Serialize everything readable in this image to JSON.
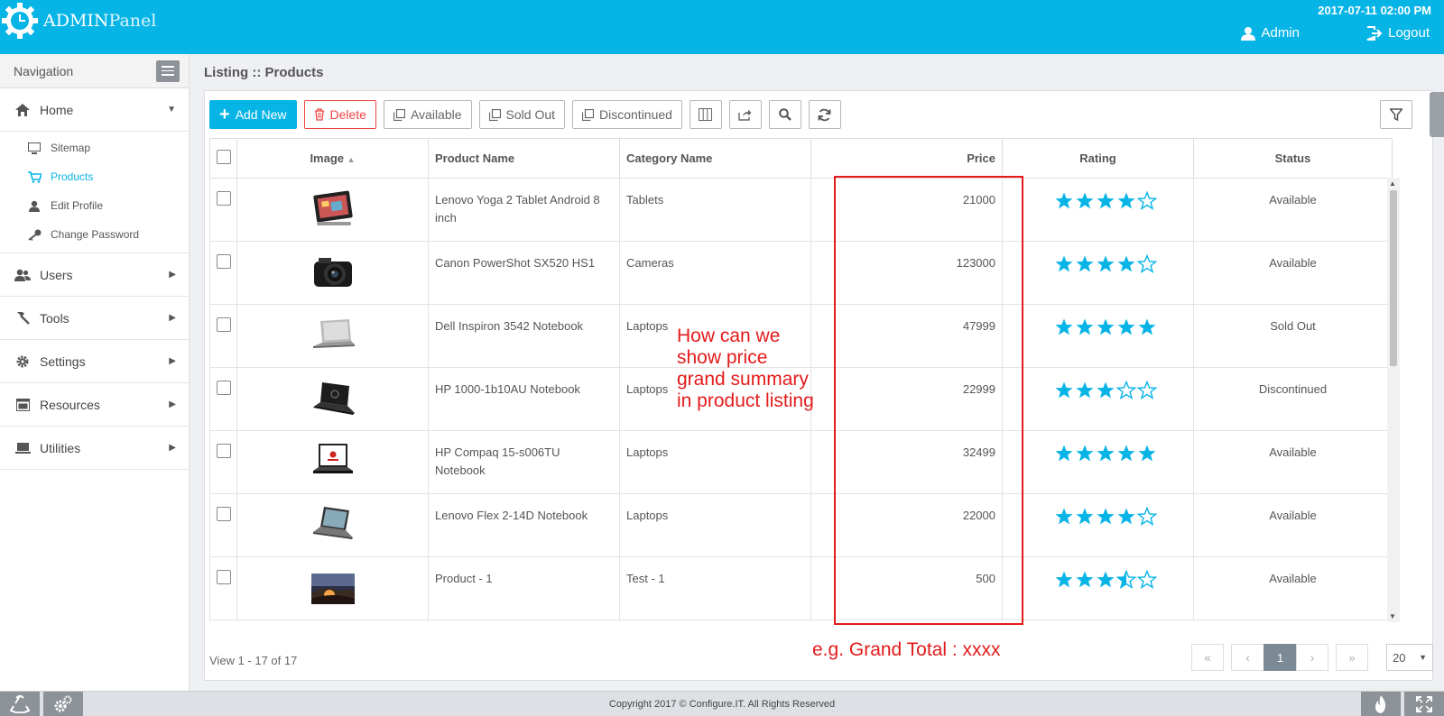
{
  "header": {
    "brand_bold": "ADMIN",
    "brand_light": "Panel",
    "datetime": "2017-07-11 02:00 PM",
    "user_label": "Admin",
    "logout_label": "Logout"
  },
  "sidebar": {
    "title": "Navigation",
    "items": [
      {
        "label": "Home",
        "icon": "home-icon"
      },
      {
        "label": "Users",
        "icon": "users-icon"
      },
      {
        "label": "Tools",
        "icon": "hammer-icon"
      },
      {
        "label": "Settings",
        "icon": "gear-icon"
      },
      {
        "label": "Resources",
        "icon": "window-icon"
      },
      {
        "label": "Utilities",
        "icon": "laptop-icon"
      }
    ],
    "sub_items": [
      {
        "label": "Sitemap",
        "icon": "monitor-icon"
      },
      {
        "label": "Products",
        "icon": "cart-icon"
      },
      {
        "label": "Edit Profile",
        "icon": "user-icon"
      },
      {
        "label": "Change Password",
        "icon": "key-icon"
      }
    ]
  },
  "page": {
    "title": "Listing :: Products"
  },
  "toolbar": {
    "add_new": "Add New",
    "delete": "Delete",
    "available": "Available",
    "sold_out": "Sold Out",
    "discontinued": "Discontinued"
  },
  "table": {
    "columns": [
      "Image",
      "Product Name",
      "Category Name",
      "Price",
      "Rating",
      "Status"
    ],
    "rows": [
      {
        "name": "Lenovo Yoga 2 Tablet Android 8 inch",
        "category": "Tablets",
        "price": "21000",
        "rating": 4,
        "status": "Available",
        "img": "tablet"
      },
      {
        "name": "Canon PowerShot SX520 HS1",
        "category": "Cameras",
        "price": "123000",
        "rating": 4,
        "status": "Available",
        "img": "camera"
      },
      {
        "name": "Dell Inspiron 3542 Notebook",
        "category": "Laptops",
        "price": "47999",
        "rating": 5,
        "status": "Sold Out",
        "img": "laptop-silver"
      },
      {
        "name": "HP 1000-1b10AU Notebook",
        "category": "Laptops",
        "price": "22999",
        "rating": 3,
        "status": "Discontinued",
        "img": "laptop-black"
      },
      {
        "name": "HP Compaq 15-s006TU Notebook",
        "category": "Laptops",
        "price": "32499",
        "rating": 5,
        "status": "Available",
        "img": "laptop-dark"
      },
      {
        "name": "Lenovo Flex 2-14D Notebook",
        "category": "Laptops",
        "price": "22000",
        "rating": 4,
        "status": "Available",
        "img": "laptop-flex"
      },
      {
        "name": "Product - 1",
        "category": "Test - 1",
        "price": "500",
        "rating": 3.5,
        "status": "Available",
        "img": "landscape"
      }
    ]
  },
  "annotation": {
    "lines": [
      "How can we",
      "show price",
      "grand summary",
      "in product listing"
    ],
    "example": "e.g. Grand Total : xxxx"
  },
  "pager": {
    "view_info": "View 1 - 17 of 17",
    "first": "«",
    "prev": "‹",
    "current": "1",
    "next": "›",
    "last": "»",
    "page_size": "20"
  },
  "footer": {
    "copyright": "Copyright 2017 © Configure.IT. All Rights Reserved"
  },
  "colors": {
    "accent": "#07b4e6",
    "annotation": "#e31b1b",
    "delete": "#ee4444"
  }
}
